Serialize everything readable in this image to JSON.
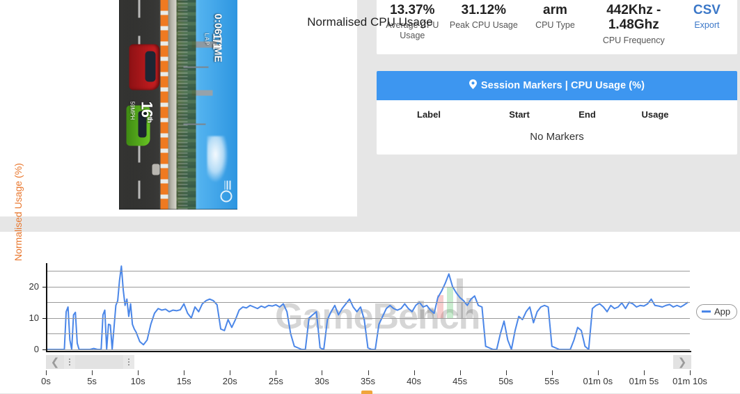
{
  "screenshot_panel": {
    "name": "session-screenshot",
    "hud": {
      "position": "16",
      "position_suffix": "th",
      "speed": "59",
      "speed_unit": "MPH",
      "lap": "1",
      "lap_total": "/1",
      "lap_label": "LAP",
      "timer": "0:06",
      "timer_sub": "TIME"
    }
  },
  "stats": [
    {
      "value": "13.37%",
      "label": "Average CPU Usage",
      "name": "stat-average-cpu-usage"
    },
    {
      "value": "31.12%",
      "label": "Peak CPU Usage",
      "name": "stat-peak-cpu-usage"
    },
    {
      "value": "arm",
      "label": "CPU Type",
      "name": "stat-cpu-type"
    },
    {
      "value": "442Khz - 1.48Ghz",
      "label": "CPU Frequency",
      "name": "stat-cpu-frequency"
    },
    {
      "value": "CSV",
      "label": "Export",
      "name": "stat-csv-export"
    }
  ],
  "markers": {
    "title": "Session Markers | CPU Usage (%)",
    "pin_icon": "⚑",
    "columns": [
      "Label",
      "Start",
      "End",
      "Usage"
    ],
    "empty_text": "No Markers",
    "rows": []
  },
  "chart_panel": {
    "legend_label": "App",
    "watermark_text": "GameBench"
  },
  "chart_data": {
    "type": "line",
    "title": "Normalised CPU Usage",
    "xlabel": "",
    "ylabel": "Normalised Usage (%)",
    "legend": [
      "App"
    ],
    "legend_position": "right",
    "grid": true,
    "series_color": "#4a86e8",
    "ylim": [
      0,
      27
    ],
    "yticks": [
      0,
      10,
      20
    ],
    "ygridlines": [
      0,
      5,
      10,
      15,
      20,
      25
    ],
    "xlim_seconds": [
      0,
      70
    ],
    "xticks_seconds": [
      0,
      5,
      10,
      15,
      20,
      25,
      30,
      35,
      40,
      45,
      50,
      55,
      60,
      65,
      70
    ],
    "xtick_labels": [
      "0s",
      "5s",
      "10s",
      "15s",
      "20s",
      "25s",
      "30s",
      "35s",
      "40s",
      "45s",
      "50s",
      "55s",
      "01m 0s",
      "01m 5s",
      "01m 10s"
    ],
    "series": [
      {
        "name": "App",
        "x": [
          0.0,
          0.4,
          0.8,
          1.2,
          1.6,
          2.0,
          2.2,
          2.4,
          2.6,
          2.8,
          3.0,
          3.2,
          3.4,
          3.6,
          3.8,
          4.0,
          4.4,
          4.8,
          5.2,
          5.6,
          6.0,
          6.2,
          6.4,
          6.6,
          6.8,
          7.0,
          7.2,
          7.4,
          7.6,
          7.8,
          8.0,
          8.2,
          8.4,
          8.6,
          8.8,
          9.0,
          9.2,
          9.4,
          9.6,
          9.8,
          10.0,
          10.2,
          10.6,
          11.0,
          11.4,
          11.8,
          12.2,
          12.6,
          13.0,
          13.4,
          13.8,
          14.2,
          14.6,
          15.0,
          15.4,
          15.8,
          16.2,
          16.6,
          17.0,
          17.4,
          17.8,
          18.2,
          18.6,
          19.0,
          19.4,
          19.8,
          20.2,
          20.6,
          21.0,
          21.4,
          21.8,
          22.2,
          22.6,
          23.0,
          23.4,
          23.8,
          24.2,
          24.6,
          25.0,
          25.4,
          25.8,
          26.2,
          26.6,
          27.0,
          27.4,
          27.8,
          28.2,
          28.6,
          29.0,
          29.4,
          29.8,
          30.2,
          30.6,
          31.0,
          31.4,
          31.8,
          32.2,
          32.6,
          33.0,
          33.4,
          33.8,
          34.2,
          34.6,
          35.0,
          35.4,
          35.8,
          36.2,
          36.6,
          37.0,
          37.4,
          37.8,
          38.2,
          38.6,
          39.0,
          39.4,
          39.8,
          40.2,
          40.6,
          41.0,
          41.4,
          41.8,
          42.2,
          42.6,
          43.0,
          43.4,
          43.8,
          44.2,
          44.6,
          45.0,
          45.4,
          45.8,
          46.2,
          46.6,
          47.0,
          47.4,
          47.8,
          48.2,
          48.6,
          49.0,
          49.4,
          49.8,
          50.2,
          50.6,
          51.0,
          51.4,
          51.8,
          52.2,
          52.6,
          53.0,
          53.4,
          53.8,
          54.2,
          54.6,
          55.0,
          55.4,
          55.8,
          56.2,
          56.6,
          57.0,
          57.4,
          57.8,
          58.2,
          58.6,
          59.0,
          59.4,
          59.8,
          60.2,
          60.6,
          61.0,
          61.4,
          61.8,
          62.2,
          62.6,
          63.0,
          63.4,
          63.8,
          64.2,
          64.6,
          65.0,
          65.4,
          65.8,
          66.2,
          66.6,
          67.0,
          67.4,
          67.8,
          68.2,
          68.6,
          69.0,
          69.4,
          69.8
        ],
        "y": [
          0,
          0,
          0,
          0,
          0,
          0,
          12,
          13.5,
          3,
          0,
          11,
          11.8,
          2,
          0,
          0,
          0,
          0,
          0,
          0.3,
          0,
          0,
          11,
          12.5,
          0,
          8,
          7.8,
          0,
          7,
          14,
          15.5,
          22,
          26.5,
          19,
          14,
          16,
          10.5,
          14.5,
          8,
          6.5,
          5.5,
          4,
          2.5,
          1.5,
          3,
          8,
          11.5,
          13,
          12.5,
          12.8,
          12,
          12.5,
          12.3,
          12.6,
          14.5,
          11.5,
          10,
          13.5,
          12,
          14.5,
          15.5,
          16,
          15.5,
          14.2,
          6.5,
          6,
          9.5,
          7,
          9.5,
          12.5,
          13.5,
          13.2,
          14,
          13.5,
          13,
          13.8,
          13.3,
          14,
          13.8,
          14.2,
          13.5,
          14.5,
          12,
          5,
          1,
          0.5,
          0,
          0,
          10,
          11,
          12,
          0.5,
          0,
          9.5,
          12,
          14,
          11,
          13,
          14.5,
          16,
          13.5,
          12,
          13.5,
          9.5,
          0.5,
          0,
          0,
          8,
          10.5,
          13,
          14,
          13,
          12.5,
          13,
          14.5,
          13,
          12,
          14,
          15,
          13.5,
          14,
          12.5,
          11.5,
          16.5,
          18.5,
          21,
          24,
          20,
          18,
          16.5,
          15.5,
          14,
          16,
          17,
          14,
          13.5,
          1,
          0.5,
          0,
          0,
          5,
          9,
          3,
          0,
          6,
          10.5,
          9.5,
          12,
          13.5,
          8.5,
          12,
          13.5,
          14,
          13.5,
          1,
          0.5,
          0,
          0,
          0,
          0,
          3,
          7,
          6,
          1,
          0,
          13,
          14,
          14.5,
          13.5,
          12,
          14,
          13,
          13.5,
          14.8,
          13,
          15,
          14.5,
          13.5,
          14,
          13.8,
          14.5,
          16,
          14,
          13.8,
          13.5,
          14,
          14.3,
          13.5,
          14,
          13.5,
          14.2,
          15,
          14,
          13.5,
          14.5,
          13.5,
          14,
          14.2,
          14.5,
          13.8,
          14,
          15,
          13.5,
          14,
          13.5,
          14,
          13.8,
          14.5,
          14.8,
          14,
          13.5,
          14,
          14.5,
          15.5,
          13.8,
          14,
          13.5,
          15,
          14,
          13.5,
          14.5,
          14,
          13.8,
          14,
          1,
          0.5,
          0,
          0,
          5.5,
          3,
          0,
          0,
          13,
          14,
          14.5,
          13,
          13.5,
          14,
          1,
          0,
          8,
          13.5,
          0,
          1,
          12,
          13.5,
          0,
          0.5,
          5,
          8
        ]
      }
    ]
  }
}
